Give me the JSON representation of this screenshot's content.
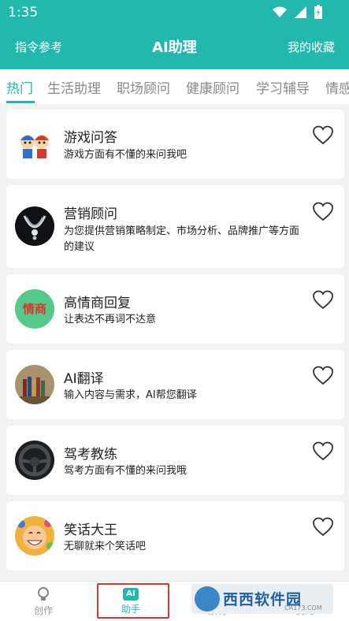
{
  "status": {
    "time": "1:35"
  },
  "header": {
    "left_link": "指令参考",
    "title": "AI助理",
    "right_link": "我的收藏"
  },
  "tabs": [
    {
      "label": "热门",
      "active": true
    },
    {
      "label": "生活助理"
    },
    {
      "label": "职场顾问"
    },
    {
      "label": "健康顾问"
    },
    {
      "label": "学习辅导"
    },
    {
      "label": "情感"
    }
  ],
  "assistants": [
    {
      "name": "游戏问答",
      "desc": "游戏方面有不懂的来问我吧",
      "icon": "cartoon-kids-avatar"
    },
    {
      "name": "营销顾问",
      "desc": "为您提供营销策略制定、市场分析、品牌推广等方面的建议",
      "icon": "necklace-avatar"
    },
    {
      "name": "高情商回复",
      "desc": "让表达不再词不达意",
      "icon": "text-badge-avatar",
      "badge": "情商"
    },
    {
      "name": "AI翻译",
      "desc": "输入内容与需求，AI帮您翻译",
      "icon": "books-avatar"
    },
    {
      "name": "驾考教练",
      "desc": "驾考方面有不懂的来问我哦",
      "icon": "steering-wheel-avatar"
    },
    {
      "name": "笑话大王",
      "desc": "无聊就来个笑话吧",
      "icon": "laughing-man-avatar"
    }
  ],
  "bottom_nav": [
    {
      "label": "创作",
      "icon": "bulb-icon"
    },
    {
      "label": "助手",
      "icon": "ai-badge-icon",
      "badge": "AI",
      "active": true
    },
    {
      "label": "素材",
      "icon": "image-icon"
    },
    {
      "label": "我的",
      "icon": "person-icon"
    }
  ],
  "watermark": {
    "text": "西西软件园",
    "sub": "CR173.COM"
  },
  "colors": {
    "primary": "#23b8ad",
    "highlight": "#d33a2c"
  }
}
